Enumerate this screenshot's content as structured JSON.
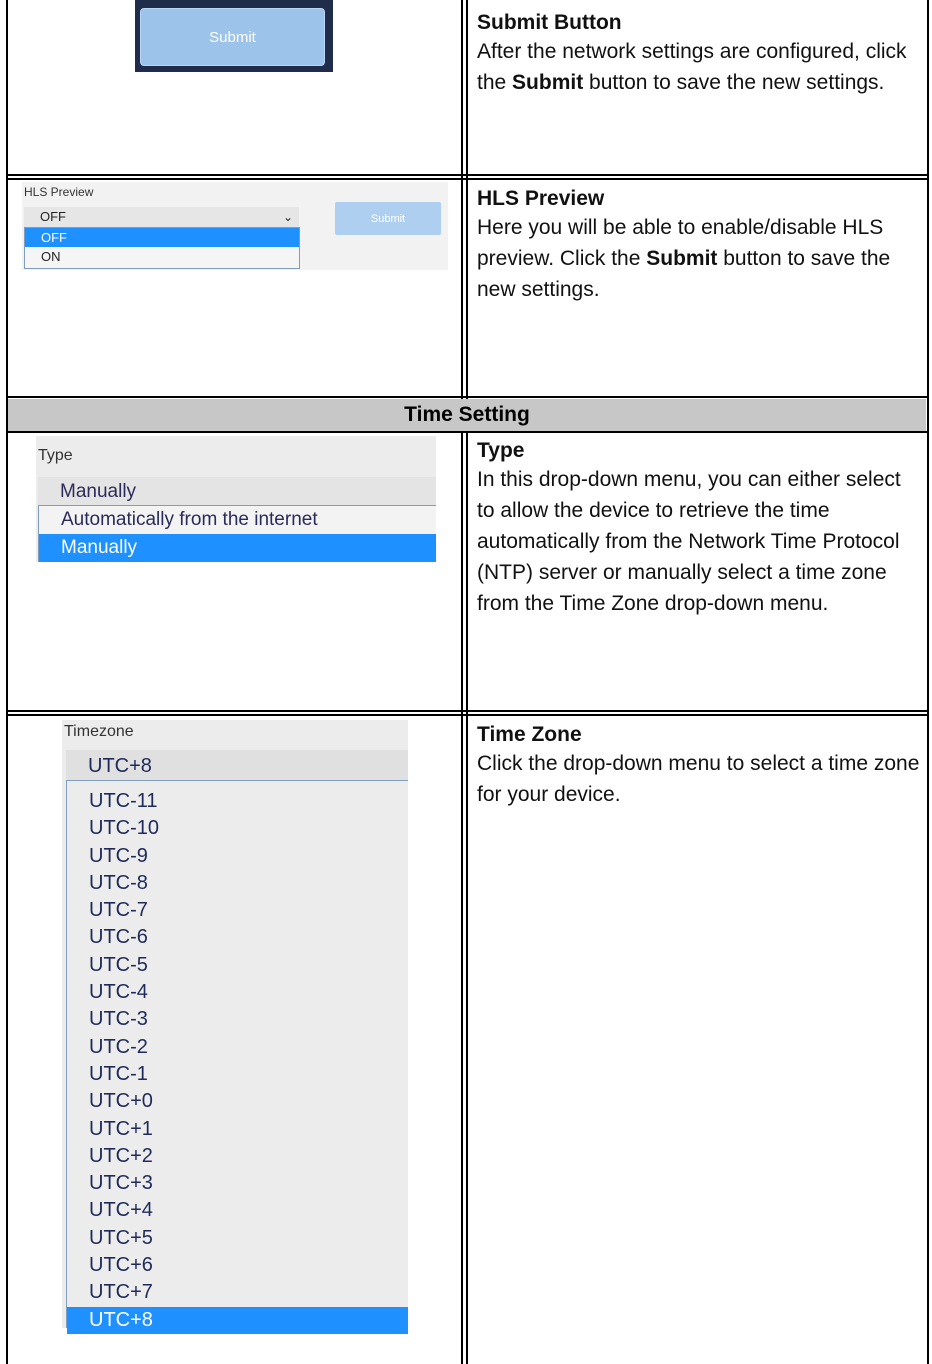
{
  "rows": {
    "submit": {
      "button_label": "Submit",
      "title": "Submit Button",
      "desc_before": "After the network settings are configured, click the ",
      "desc_bold": "Submit",
      "desc_after": " button to save the new settings."
    },
    "hls": {
      "field_label": "HLS Preview",
      "current": "OFF",
      "options": [
        "OFF",
        "ON"
      ],
      "button_label": "Submit",
      "title": "HLS Preview",
      "desc_before": "Here you will be able to enable/disable HLS preview. Click the ",
      "desc_bold": "Submit",
      "desc_after": " button to save the new settings."
    },
    "section_header": "Time Setting",
    "type": {
      "field_label": "Type",
      "current": "Manually",
      "options": [
        "Automatically from the internet",
        "Manually"
      ],
      "title": "Type",
      "desc": "In this drop-down menu, you can either select to allow the device to retrieve the time automatically from the Network Time Protocol (NTP) server or manually select a time zone from the Time Zone drop-down menu."
    },
    "timezone": {
      "field_label": "Timezone",
      "current": "UTC+8",
      "options": [
        "UTC-11",
        "UTC-10",
        "UTC-9",
        "UTC-8",
        "UTC-7",
        "UTC-6",
        "UTC-5",
        "UTC-4",
        "UTC-3",
        "UTC-2",
        "UTC-1",
        "UTC+0",
        "UTC+1",
        "UTC+2",
        "UTC+3",
        "UTC+4",
        "UTC+5",
        "UTC+6",
        "UTC+7",
        "UTC+8"
      ],
      "title": "Time Zone",
      "desc": "Click the drop-down menu to select a time zone for your device."
    }
  },
  "colors": {
    "highlight": "#1e90ff",
    "header_bg": "#c7c7c7"
  }
}
